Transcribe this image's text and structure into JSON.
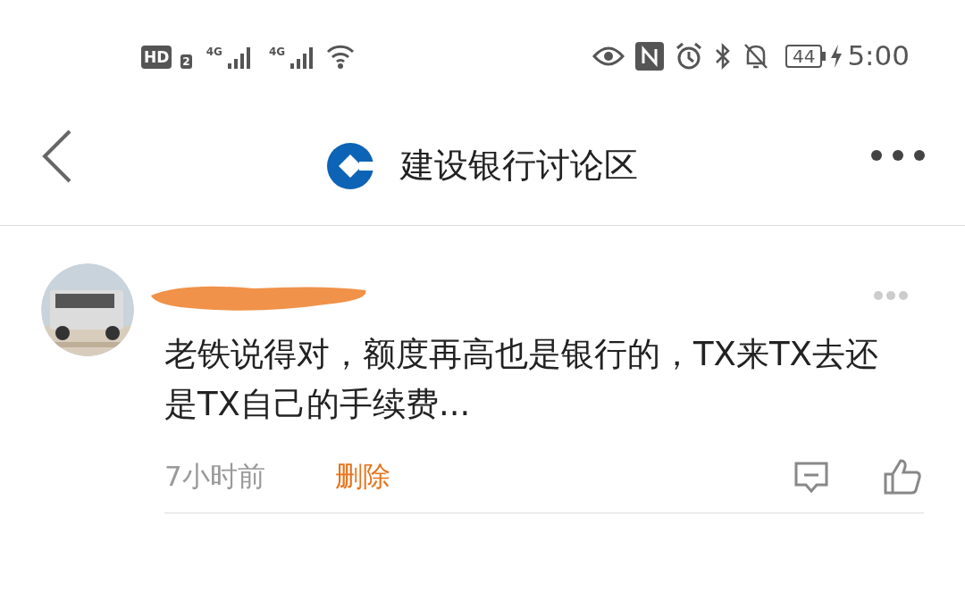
{
  "status_bar": {
    "hd": "HD",
    "hd_sub": "2",
    "signals": [
      "4G",
      "4G"
    ],
    "battery": "44",
    "time": "5:00"
  },
  "header": {
    "title": "建设银行讨论区"
  },
  "comment": {
    "text": "老铁说得对，额度再高也是银行的，TX来TX去还是TX自己的手续费...",
    "time": "7小时前",
    "delete": "删除"
  }
}
